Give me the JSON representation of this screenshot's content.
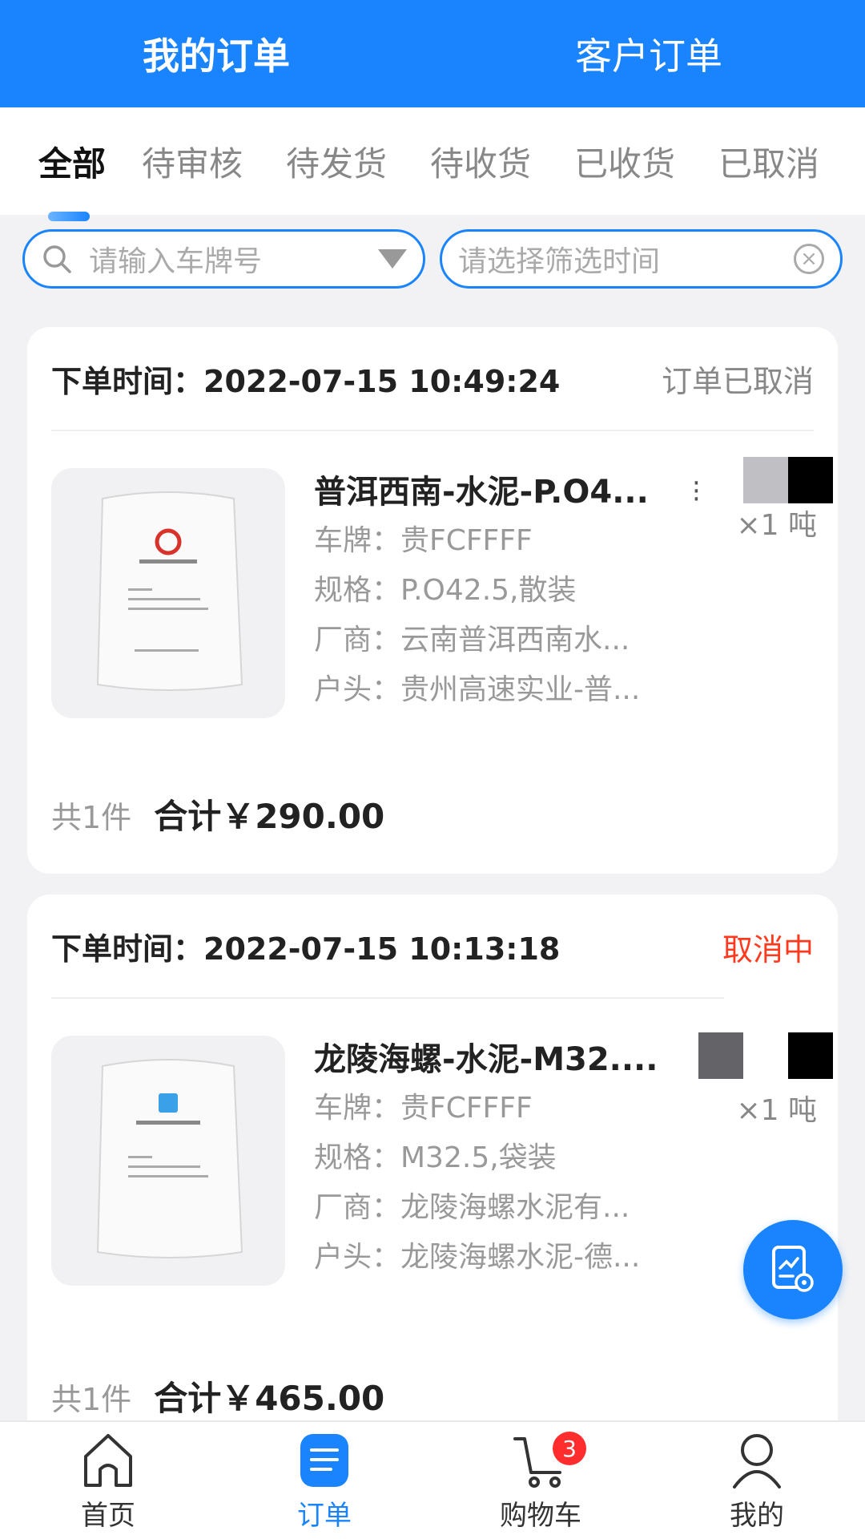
{
  "header": {
    "tabs": [
      {
        "label": "我的订单"
      },
      {
        "label": "客户订单"
      }
    ]
  },
  "status_tabs": [
    {
      "label": "全部"
    },
    {
      "label": "待审核"
    },
    {
      "label": "待发货"
    },
    {
      "label": "待收货"
    },
    {
      "label": "已收货"
    },
    {
      "label": "已取消"
    }
  ],
  "filters": {
    "plate_placeholder": "请输入车牌号",
    "time_placeholder": "请选择筛选时间"
  },
  "orders": [
    {
      "time": "下单时间：2022-07-15 10:49:24",
      "status": "订单已取消",
      "product_name": "普洱西南-水泥-P.O4...",
      "plate": "车牌：贵FCFFFF",
      "spec": "规格：P.O42.5,散装",
      "vendor": "厂商：云南普洱西南水...",
      "account": "户头：贵州高速实业-普...",
      "qty": "×1 吨",
      "count": "共1件",
      "total": "合计￥290.00"
    },
    {
      "time": "下单时间：2022-07-15 10:13:18",
      "status": "取消中",
      "product_name": "龙陵海螺-水泥-M32....",
      "plate": "车牌：贵FCFFFF",
      "spec": "规格：M32.5,袋装",
      "vendor": "厂商：龙陵海螺水泥有...",
      "account": "户头：龙陵海螺水泥-德...",
      "qty": "×1 吨",
      "count": "共1件",
      "total": "合计￥465.00"
    }
  ],
  "bottom_nav": [
    {
      "label": "首页"
    },
    {
      "label": "订单"
    },
    {
      "label": "购物车",
      "badge": "3"
    },
    {
      "label": "我的"
    }
  ],
  "colors": {
    "primary": "#1a84ff",
    "danger": "#ff3a1f"
  }
}
